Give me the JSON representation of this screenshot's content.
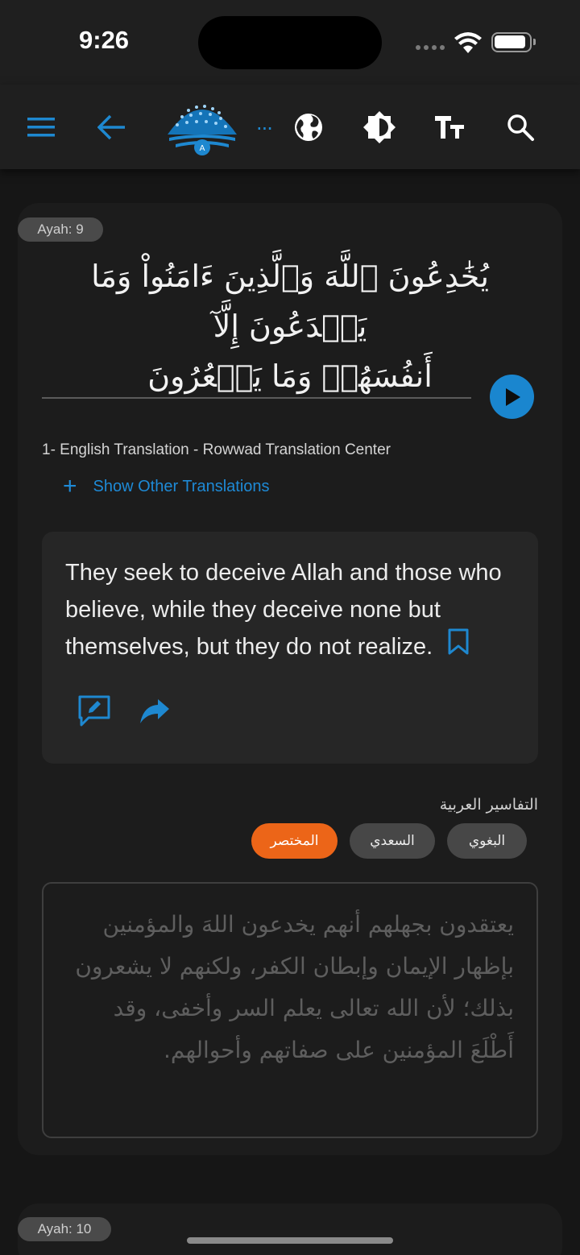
{
  "status_bar": {
    "time": "9:26"
  },
  "toolbar": {
    "icons": [
      "menu-icon",
      "back-arrow-icon",
      "app-logo",
      "more-icon",
      "globe-icon",
      "theme-icon",
      "text-size-icon",
      "search-icon"
    ],
    "more_label": "...",
    "accent_color": "#1e88d0"
  },
  "ayah": {
    "badge": "Ayah: 9",
    "arabic_line1": "يُخَٰدِعُونَ ٱللَّهَ وَٱلَّذِينَ ءَامَنُواْ وَمَا يَخۡدَعُونَ إِلَّآ",
    "arabic_line2": "أَنفُسَهُمۡ وَمَا يَشۡعُرُونَ",
    "play_color": "#1a86cf"
  },
  "translation": {
    "title": "1- English Translation - Rowwad Translation Center",
    "show_other": "Show Other Translations",
    "text": "They seek to deceive Allah and those who believe, while they deceive none but themselves, but they do not realize."
  },
  "tafsir": {
    "label": "التفاسير العربية",
    "chips": [
      {
        "label": "البغوي",
        "selected": false
      },
      {
        "label": "السعدي",
        "selected": false
      },
      {
        "label": "المختصر",
        "selected": true
      }
    ],
    "selected_color": "#ec6518",
    "text": "يعتقدون بجهلهم أنهم يخدعون اللهَ والمؤمنين بإظهار الإيمان وإبطان الكفر، ولكنهم لا يشعرون بذلك؛ لأن الله تعالى يعلم السر وأخفى، وقد أَطْلَعَ المؤمنين على صفاتهم وأحوالهم."
  },
  "next_ayah": {
    "badge": "Ayah: 10"
  }
}
